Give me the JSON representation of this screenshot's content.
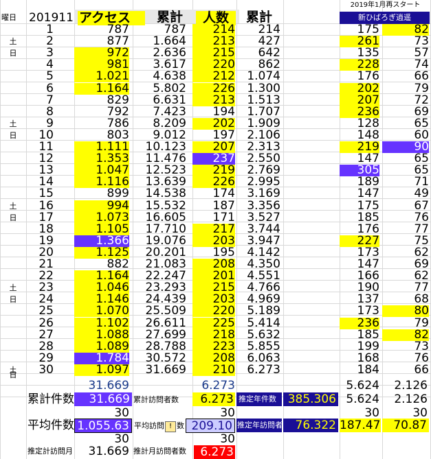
{
  "banner": "2019年1月再スタート",
  "header": {
    "weekday": "曜日",
    "month": "201911",
    "access": "アクセス",
    "cumulative1": "累計",
    "people": "人数",
    "cumulative2": "累計",
    "blog_name": "新ひばろぎ逍遥"
  },
  "days": [
    {
      "day": "1",
      "wd": "",
      "access": "787",
      "cum": "787",
      "people": "214",
      "pcum": "214",
      "c1": "175",
      "c2": "82"
    },
    {
      "day": "2",
      "wd": "土",
      "access": "877",
      "cum": "1.664",
      "people": "213",
      "pcum": "427",
      "c1": "261",
      "c2": "73"
    },
    {
      "day": "3",
      "wd": "日",
      "access": "972",
      "cum": "2.636",
      "people": "215",
      "pcum": "642",
      "c1": "135",
      "c2": "57"
    },
    {
      "day": "4",
      "wd": "",
      "access": "981",
      "cum": "3.617",
      "people": "220",
      "pcum": "862",
      "c1": "228",
      "c2": "74"
    },
    {
      "day": "5",
      "wd": "",
      "access": "1.021",
      "cum": "4.638",
      "people": "212",
      "pcum": "1.074",
      "c1": "176",
      "c2": "66"
    },
    {
      "day": "6",
      "wd": "",
      "access": "1.164",
      "cum": "5.802",
      "people": "226",
      "pcum": "1.300",
      "c1": "202",
      "c2": "79"
    },
    {
      "day": "7",
      "wd": "",
      "access": "829",
      "cum": "6.631",
      "people": "213",
      "pcum": "1.513",
      "c1": "207",
      "c2": "72"
    },
    {
      "day": "8",
      "wd": "",
      "access": "792",
      "cum": "7.423",
      "people": "194",
      "pcum": "1.707",
      "c1": "236",
      "c2": "69"
    },
    {
      "day": "9",
      "wd": "土",
      "access": "786",
      "cum": "8.209",
      "people": "202",
      "pcum": "1.909",
      "c1": "128",
      "c2": "65"
    },
    {
      "day": "10",
      "wd": "日",
      "access": "803",
      "cum": "9.012",
      "people": "197",
      "pcum": "2.106",
      "c1": "148",
      "c2": "60"
    },
    {
      "day": "11",
      "wd": "",
      "access": "1.111",
      "cum": "10.123",
      "people": "207",
      "pcum": "2.313",
      "c1": "219",
      "c2": "90"
    },
    {
      "day": "12",
      "wd": "",
      "access": "1.353",
      "cum": "11.476",
      "people": "237",
      "pcum": "2.550",
      "c1": "147",
      "c2": "65"
    },
    {
      "day": "13",
      "wd": "",
      "access": "1.047",
      "cum": "12.523",
      "people": "219",
      "pcum": "2.769",
      "c1": "305",
      "c2": "65"
    },
    {
      "day": "14",
      "wd": "",
      "access": "1.116",
      "cum": "13.639",
      "people": "226",
      "pcum": "2.995",
      "c1": "189",
      "c2": "71"
    },
    {
      "day": "15",
      "wd": "",
      "access": "899",
      "cum": "14.538",
      "people": "174",
      "pcum": "3.169",
      "c1": "147",
      "c2": "49"
    },
    {
      "day": "16",
      "wd": "土",
      "access": "994",
      "cum": "15.532",
      "people": "187",
      "pcum": "3.356",
      "c1": "175",
      "c2": "67"
    },
    {
      "day": "17",
      "wd": "日",
      "access": "1.073",
      "cum": "16.605",
      "people": "171",
      "pcum": "3.527",
      "c1": "185",
      "c2": "76"
    },
    {
      "day": "18",
      "wd": "",
      "access": "1.105",
      "cum": "17.710",
      "people": "217",
      "pcum": "3.744",
      "c1": "176",
      "c2": "77"
    },
    {
      "day": "19",
      "wd": "",
      "access": "1.366",
      "cum": "19.076",
      "people": "203",
      "pcum": "3.947",
      "c1": "227",
      "c2": "75"
    },
    {
      "day": "20",
      "wd": "",
      "access": "1.125",
      "cum": "20.201",
      "people": "195",
      "pcum": "4.142",
      "c1": "173",
      "c2": "62"
    },
    {
      "day": "21",
      "wd": "",
      "access": "882",
      "cum": "21.083",
      "people": "208",
      "pcum": "4.350",
      "c1": "147",
      "c2": "69"
    },
    {
      "day": "22",
      "wd": "",
      "access": "1.164",
      "cum": "22.247",
      "people": "201",
      "pcum": "4.551",
      "c1": "166",
      "c2": "62"
    },
    {
      "day": "23",
      "wd": "土",
      "access": "1.046",
      "cum": "23.293",
      "people": "215",
      "pcum": "4.766",
      "c1": "190",
      "c2": "77"
    },
    {
      "day": "24",
      "wd": "日",
      "access": "1.146",
      "cum": "24.439",
      "people": "203",
      "pcum": "4.969",
      "c1": "137",
      "c2": "68"
    },
    {
      "day": "25",
      "wd": "",
      "access": "1.070",
      "cum": "25.509",
      "people": "220",
      "pcum": "5.189",
      "c1": "173",
      "c2": "80"
    },
    {
      "day": "26",
      "wd": "",
      "access": "1.102",
      "cum": "26.611",
      "people": "225",
      "pcum": "5.414",
      "c1": "236",
      "c2": "79"
    },
    {
      "day": "27",
      "wd": "",
      "access": "1.088",
      "cum": "27.699",
      "people": "218",
      "pcum": "5.632",
      "c1": "185",
      "c2": "82"
    },
    {
      "day": "28",
      "wd": "",
      "access": "1.089",
      "cum": "28.788",
      "people": "223",
      "pcum": "5.855",
      "c1": "199",
      "c2": "73"
    },
    {
      "day": "29",
      "wd": "",
      "access": "1.784",
      "cum": "30.572",
      "people": "208",
      "pcum": "6.063",
      "c1": "168",
      "c2": "76"
    },
    {
      "day": "30",
      "wd": "土",
      "access": "1.097",
      "cum": "31.669",
      "people": "210",
      "pcum": "6.273",
      "c1": "184",
      "c2": "66"
    }
  ],
  "extra_wd": "日",
  "footer": {
    "total_access": "31.669",
    "total_people": "6.273",
    "total_c1": "5.624",
    "total_c2": "2.126",
    "cum_label": "累計件数",
    "cum_value": "31.669",
    "cum_visit_label": "累計訪問者数",
    "cum_visit_value": "6.273",
    "est_year_label": "推定年件数",
    "est_year_value": "385.306",
    "cum_c1": "5.624",
    "cum_c2": "2.126",
    "days_a": "30",
    "days_p": "30",
    "days_c1": "30",
    "days_c2": "30",
    "avg_label": "平均件数",
    "avg_value": "1.055.63",
    "avg_visit_label_a": "平均訪問",
    "avg_visit_label_b": "数",
    "avg_visit_value": "209.10",
    "est_year_visit_label": "推定年訪問者",
    "est_year_visit_value": "76.322",
    "avg_c1": "187.47",
    "avg_c2": "70.87",
    "days2_a": "30",
    "days2_p": "30",
    "est_month_label": "推定計訪問月",
    "est_month_value": "31.669",
    "est_month_visit_label": "推計月訪問者数",
    "est_month_visit_value": "6.273"
  },
  "highlights": {
    "access_yellow": [
      3,
      4,
      5,
      6,
      11,
      12,
      13,
      14,
      16,
      17,
      18,
      20,
      22,
      23,
      24,
      25,
      26,
      27,
      28,
      30
    ],
    "access_purple": [
      19,
      29
    ],
    "people_yellow": [
      1,
      2,
      3,
      4,
      5,
      6,
      7,
      9,
      11,
      13,
      14,
      18,
      19,
      21,
      22,
      23,
      24,
      25,
      26,
      27,
      28,
      29,
      30
    ],
    "people_purple": [
      12
    ],
    "c1_yellow": [
      2,
      4,
      6,
      7,
      8,
      11,
      19,
      26
    ],
    "c1_purple": [
      13
    ],
    "c2_yellow": [
      1,
      25,
      27
    ],
    "c2_purple": [
      11
    ]
  }
}
